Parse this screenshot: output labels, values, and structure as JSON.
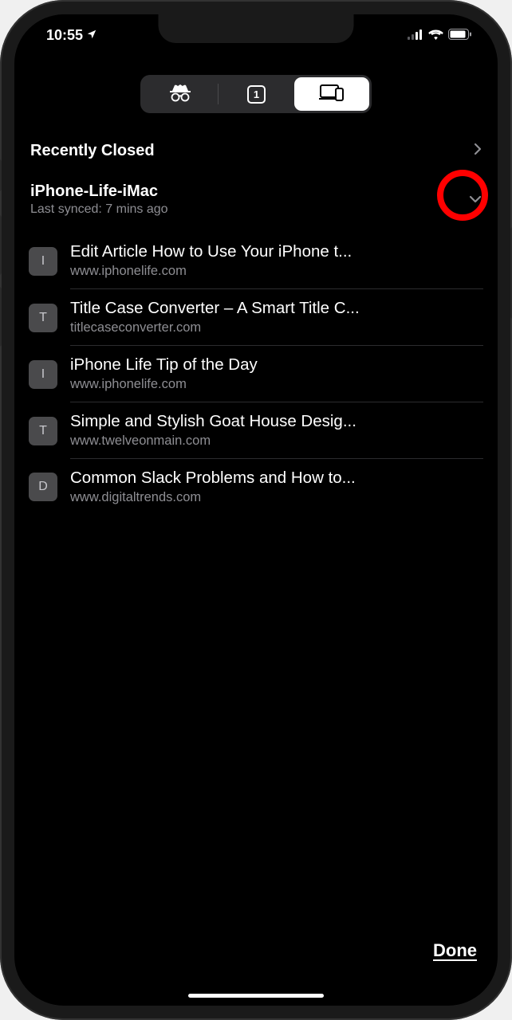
{
  "statusBar": {
    "time": "10:55"
  },
  "segmented": {
    "tabCount": "1"
  },
  "recentlyClosed": {
    "title": "Recently Closed"
  },
  "device": {
    "name": "iPhone-Life-iMac",
    "syncText": "Last synced: 7 mins ago"
  },
  "tabs": [
    {
      "favicon": "I",
      "title": "Edit Article How to Use Your iPhone t...",
      "url": "www.iphonelife.com"
    },
    {
      "favicon": "T",
      "title": "Title Case Converter – A Smart Title C...",
      "url": "titlecaseconverter.com"
    },
    {
      "favicon": "I",
      "title": "iPhone Life Tip of the Day",
      "url": "www.iphonelife.com"
    },
    {
      "favicon": "T",
      "title": "Simple and Stylish Goat House Desig...",
      "url": "www.twelveonmain.com"
    },
    {
      "favicon": "D",
      "title": "Common Slack Problems and How to...",
      "url": "www.digitaltrends.com"
    }
  ],
  "bottomBar": {
    "done": "Done"
  }
}
